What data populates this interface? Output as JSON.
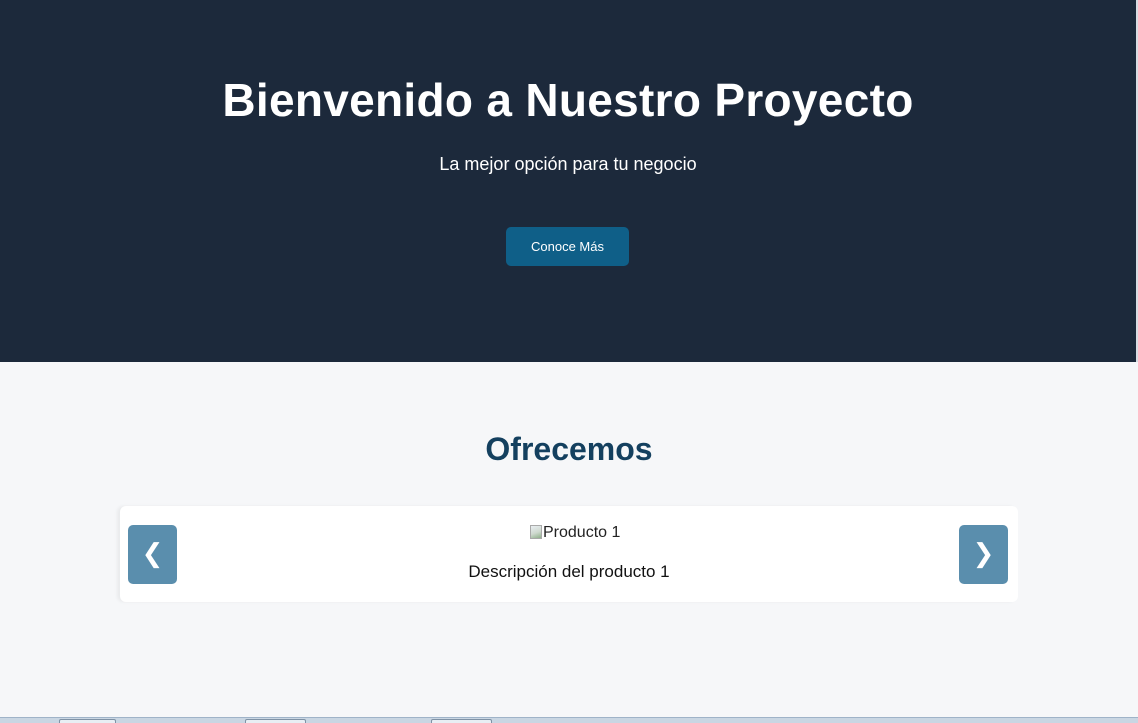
{
  "hero": {
    "title": "Bienvenido a Nuestro Proyecto",
    "subtitle": "La mejor opción para tu negocio",
    "cta_label": "Conoce Más"
  },
  "services": {
    "title": "Ofrecemos",
    "prev_label": "❮",
    "next_label": "❯",
    "slide": {
      "image_alt": "Producto 1",
      "description": "Descripción del producto 1"
    }
  },
  "colors": {
    "hero_bg": "#1c293b",
    "cta_bg": "#0f5f88",
    "section_title": "#14405f",
    "carousel_button": "#5a8ead",
    "page_bg": "#f6f7f9"
  },
  "icons": {
    "prev": "chevron-left-icon",
    "next": "chevron-right-icon",
    "image": "broken-image-icon"
  }
}
